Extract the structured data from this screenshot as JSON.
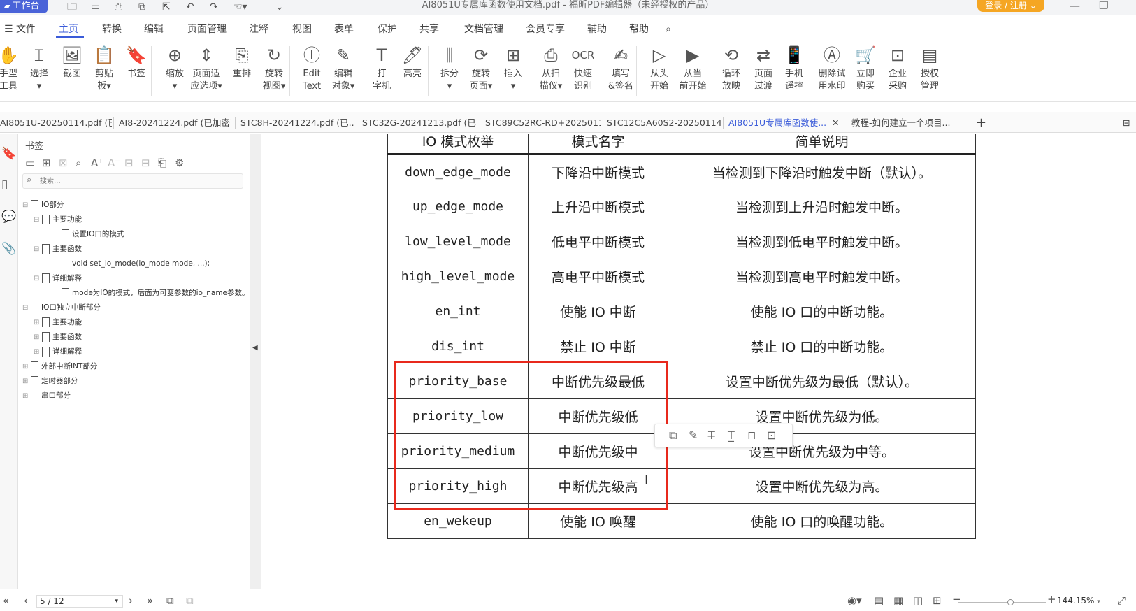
{
  "titlebar": {
    "workbench_label": "工作台",
    "doc_title": "AI8051U专属库函数使用文档.pdf - 福昕PDF编辑器（未经授权的产品）",
    "login_label": "登录 / 注册"
  },
  "menu": {
    "file_label": "文件",
    "items": [
      "主页",
      "转换",
      "编辑",
      "页面管理",
      "注释",
      "视图",
      "表单",
      "保护",
      "共享",
      "文档管理",
      "会员专享",
      "辅助",
      "帮助"
    ],
    "active_index": 0
  },
  "ribbon": {
    "tools": [
      {
        "l1": "手型",
        "l2": "工具",
        "icon": "hand-icon"
      },
      {
        "l1": "选择",
        "l2": "▾",
        "icon": "select-icon"
      },
      {
        "l1": "截图",
        "l2": "",
        "icon": "screenshot-icon"
      },
      {
        "l1": "剪贴",
        "l2": "板▾",
        "icon": "clipboard-icon"
      },
      {
        "l1": "书签",
        "l2": "",
        "icon": "bookmark-icon"
      },
      {
        "l1": "缩放",
        "l2": "▾",
        "icon": "zoom-icon"
      },
      {
        "l1": "页面适",
        "l2": "应选项▾",
        "icon": "fit-page-icon"
      },
      {
        "l1": "重排",
        "l2": "",
        "icon": "reflow-icon"
      },
      {
        "l1": "旋转",
        "l2": "视图▾",
        "icon": "rotate-view-icon"
      },
      {
        "l1": "Edit",
        "l2": "Text",
        "icon": "edit-text-icon"
      },
      {
        "l1": "编辑",
        "l2": "对象▾",
        "icon": "edit-object-icon"
      },
      {
        "l1": "打",
        "l2": "字机",
        "icon": "typewriter-icon"
      },
      {
        "l1": "高亮",
        "l2": "",
        "icon": "highlight-icon"
      },
      {
        "l1": "拆分",
        "l2": "▾",
        "icon": "split-icon"
      },
      {
        "l1": "旋转",
        "l2": "页面▾",
        "icon": "rotate-page-icon"
      },
      {
        "l1": "插入",
        "l2": "▾",
        "icon": "insert-icon"
      },
      {
        "l1": "从扫",
        "l2": "描仪▾",
        "icon": "scanner-icon"
      },
      {
        "l1": "快速",
        "l2": "识别",
        "icon": "ocr-icon"
      },
      {
        "l1": "填写",
        "l2": "&签名",
        "icon": "fill-sign-icon"
      },
      {
        "l1": "从头",
        "l2": "开始",
        "icon": "play-start-icon"
      },
      {
        "l1": "从当",
        "l2": "前开始",
        "icon": "play-current-icon"
      },
      {
        "l1": "循环",
        "l2": "放映",
        "icon": "loop-icon"
      },
      {
        "l1": "页面",
        "l2": "过渡",
        "icon": "transition-icon"
      },
      {
        "l1": "手机",
        "l2": "遥控",
        "icon": "phone-remote-icon"
      },
      {
        "l1": "删除试",
        "l2": "用水印",
        "icon": "remove-watermark-icon"
      },
      {
        "l1": "立即",
        "l2": "购买",
        "icon": "cart-icon"
      },
      {
        "l1": "企业",
        "l2": "采购",
        "icon": "enterprise-icon"
      },
      {
        "l1": "授权",
        "l2": "管理",
        "icon": "license-icon"
      }
    ]
  },
  "tabs": [
    {
      "label": "AI8051U-20250114.pdf (已...",
      "active": false
    },
    {
      "label": "AI8-20241224.pdf (已加密)",
      "active": false
    },
    {
      "label": "STC8H-20241224.pdf (已...",
      "active": false
    },
    {
      "label": "STC32G-20241213.pdf (已...",
      "active": false
    },
    {
      "label": "STC89C52RC-RD+2025011...",
      "active": false
    },
    {
      "label": "STC12C5A60S2-20250114...",
      "active": false
    },
    {
      "label": "AI8051U专属库函数使...",
      "active": true
    },
    {
      "label": "教程-如何建立一个项目...",
      "active": false
    }
  ],
  "bookmarks": {
    "title": "书签",
    "search_placeholder": "搜索...",
    "items": [
      {
        "label": "IO部分",
        "level": 0,
        "toggle": "⊟"
      },
      {
        "label": "主要功能",
        "level": 1,
        "toggle": "⊟"
      },
      {
        "label": "设置IO口的模式",
        "level": 2,
        "toggle": ""
      },
      {
        "label": "主要函数",
        "level": 1,
        "toggle": "⊟"
      },
      {
        "label": "void set_io_mode(io_mode mode, ...);",
        "level": 2,
        "toggle": ""
      },
      {
        "label": "详细解释",
        "level": 1,
        "toggle": "⊟"
      },
      {
        "label": "mode为IO的模式，后面为可变参数的io_name参数。",
        "level": 2,
        "toggle": ""
      },
      {
        "label": "IO口独立中断部分",
        "level": 0,
        "toggle": "⊟",
        "blue": true
      },
      {
        "label": "主要功能",
        "level": 1,
        "toggle": "⊞"
      },
      {
        "label": "主要函数",
        "level": 1,
        "toggle": "⊞"
      },
      {
        "label": "详细解释",
        "level": 1,
        "toggle": "⊞"
      },
      {
        "label": "外部中断INT部分",
        "level": 0,
        "toggle": "⊞"
      },
      {
        "label": "定时器部分",
        "level": 0,
        "toggle": "⊞"
      },
      {
        "label": "串口部分",
        "level": 0,
        "toggle": "⊞"
      }
    ]
  },
  "table": {
    "headers": [
      "IO 模式枚举",
      "模式名字",
      "简单说明"
    ],
    "rows": [
      [
        "down_edge_mode",
        "下降沿中断模式",
        "当检测到下降沿时触发中断（默认）。"
      ],
      [
        "up_edge_mode",
        "上升沿中断模式",
        "当检测到上升沿时触发中断。"
      ],
      [
        "low_level_mode",
        "低电平中断模式",
        "当检测到低电平时触发中断。"
      ],
      [
        "high_level_mode",
        "高电平中断模式",
        "当检测到高电平时触发中断。"
      ],
      [
        "en_int",
        "使能 IO 中断",
        "使能 IO 口的中断功能。"
      ],
      [
        "dis_int",
        "禁止 IO 中断",
        "禁止 IO 口的中断功能。"
      ],
      [
        "priority_base",
        "中断优先级最低",
        "设置中断优先级为最低（默认）。"
      ],
      [
        "priority_low",
        "中断优先级低",
        "设置中断优先级为低。"
      ],
      [
        "priority_medium",
        "中断优先级中",
        "设置中断优先级为中等。"
      ],
      [
        "priority_high",
        "中断优先级高",
        "设置中断优先级为高。"
      ],
      [
        "en_wekeup",
        "使能 IO 唤醒",
        "使能 IO 口的唤醒功能。"
      ]
    ]
  },
  "status": {
    "page": "5 / 12",
    "zoom": "144.15%"
  },
  "colors": {
    "accent": "#3a5bd9",
    "highlight_box": "#e8291c",
    "login": "#f5a623"
  }
}
